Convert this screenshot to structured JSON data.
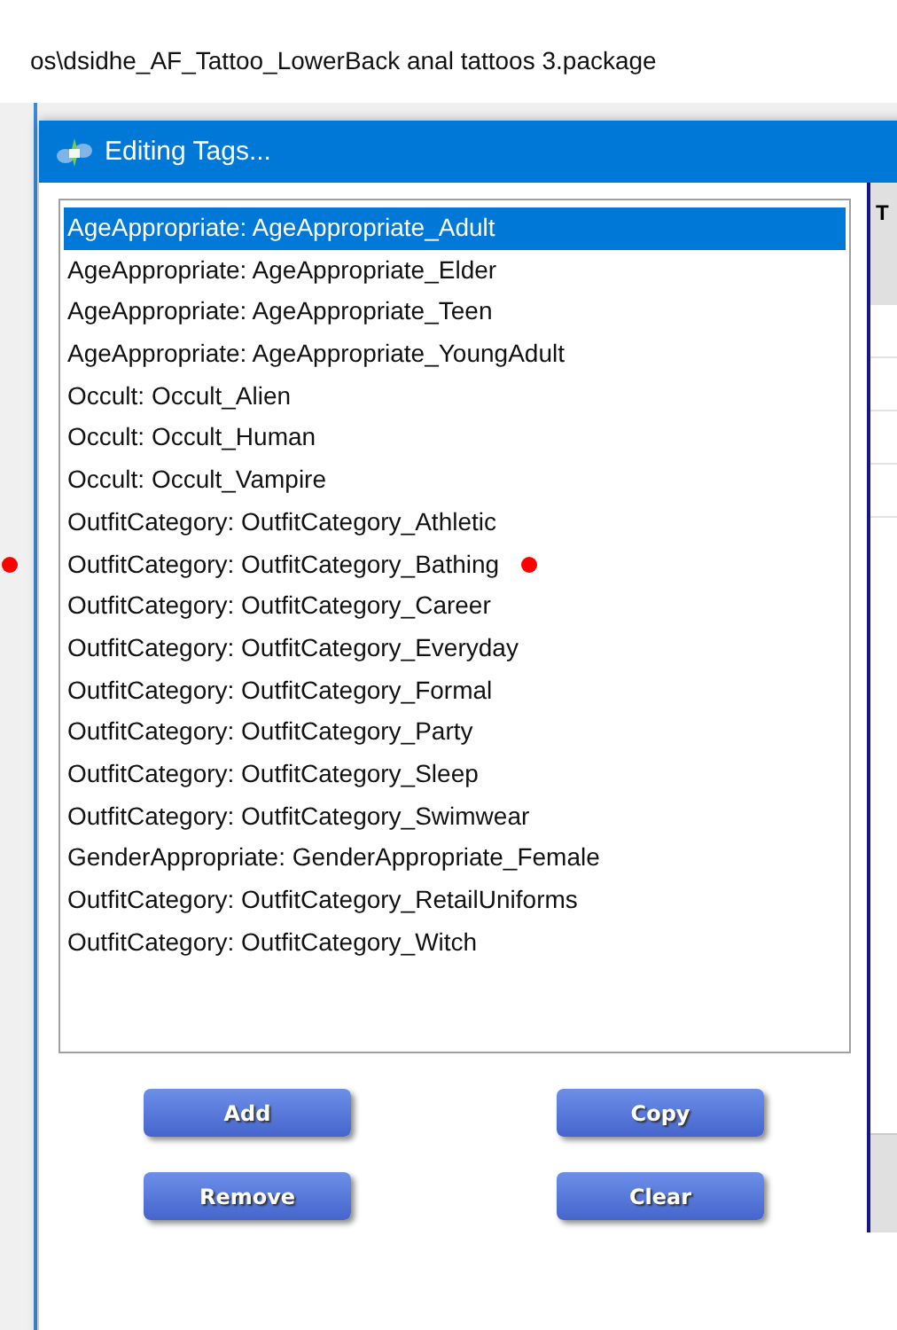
{
  "path_text": "os\\dsidhe_AF_Tattoo_LowerBack anal tattoos 3.package",
  "dialog": {
    "title": "Editing Tags...",
    "tags": [
      {
        "label": "AgeAppropriate: AgeAppropriate_Adult",
        "selected": true,
        "marked": false
      },
      {
        "label": "AgeAppropriate: AgeAppropriate_Elder",
        "selected": false,
        "marked": false
      },
      {
        "label": "AgeAppropriate: AgeAppropriate_Teen",
        "selected": false,
        "marked": false
      },
      {
        "label": "AgeAppropriate: AgeAppropriate_YoungAdult",
        "selected": false,
        "marked": false
      },
      {
        "label": "Occult: Occult_Alien",
        "selected": false,
        "marked": false
      },
      {
        "label": "Occult: Occult_Human",
        "selected": false,
        "marked": false
      },
      {
        "label": "Occult: Occult_Vampire",
        "selected": false,
        "marked": false
      },
      {
        "label": "OutfitCategory: OutfitCategory_Athletic",
        "selected": false,
        "marked": false
      },
      {
        "label": "OutfitCategory: OutfitCategory_Bathing",
        "selected": false,
        "marked": true
      },
      {
        "label": "OutfitCategory: OutfitCategory_Career",
        "selected": false,
        "marked": false
      },
      {
        "label": "OutfitCategory: OutfitCategory_Everyday",
        "selected": false,
        "marked": false
      },
      {
        "label": "OutfitCategory: OutfitCategory_Formal",
        "selected": false,
        "marked": false
      },
      {
        "label": "OutfitCategory: OutfitCategory_Party",
        "selected": false,
        "marked": false
      },
      {
        "label": "OutfitCategory: OutfitCategory_Sleep",
        "selected": false,
        "marked": false
      },
      {
        "label": "OutfitCategory: OutfitCategory_Swimwear",
        "selected": false,
        "marked": false
      },
      {
        "label": "GenderAppropriate: GenderAppropriate_Female",
        "selected": false,
        "marked": false
      },
      {
        "label": "OutfitCategory: OutfitCategory_RetailUniforms",
        "selected": false,
        "marked": false
      },
      {
        "label": "OutfitCategory: OutfitCategory_Witch",
        "selected": false,
        "marked": false
      }
    ],
    "buttons": [
      "Add",
      "Copy",
      "Remove",
      "Clear"
    ]
  },
  "side_panel": {
    "header": "T"
  }
}
